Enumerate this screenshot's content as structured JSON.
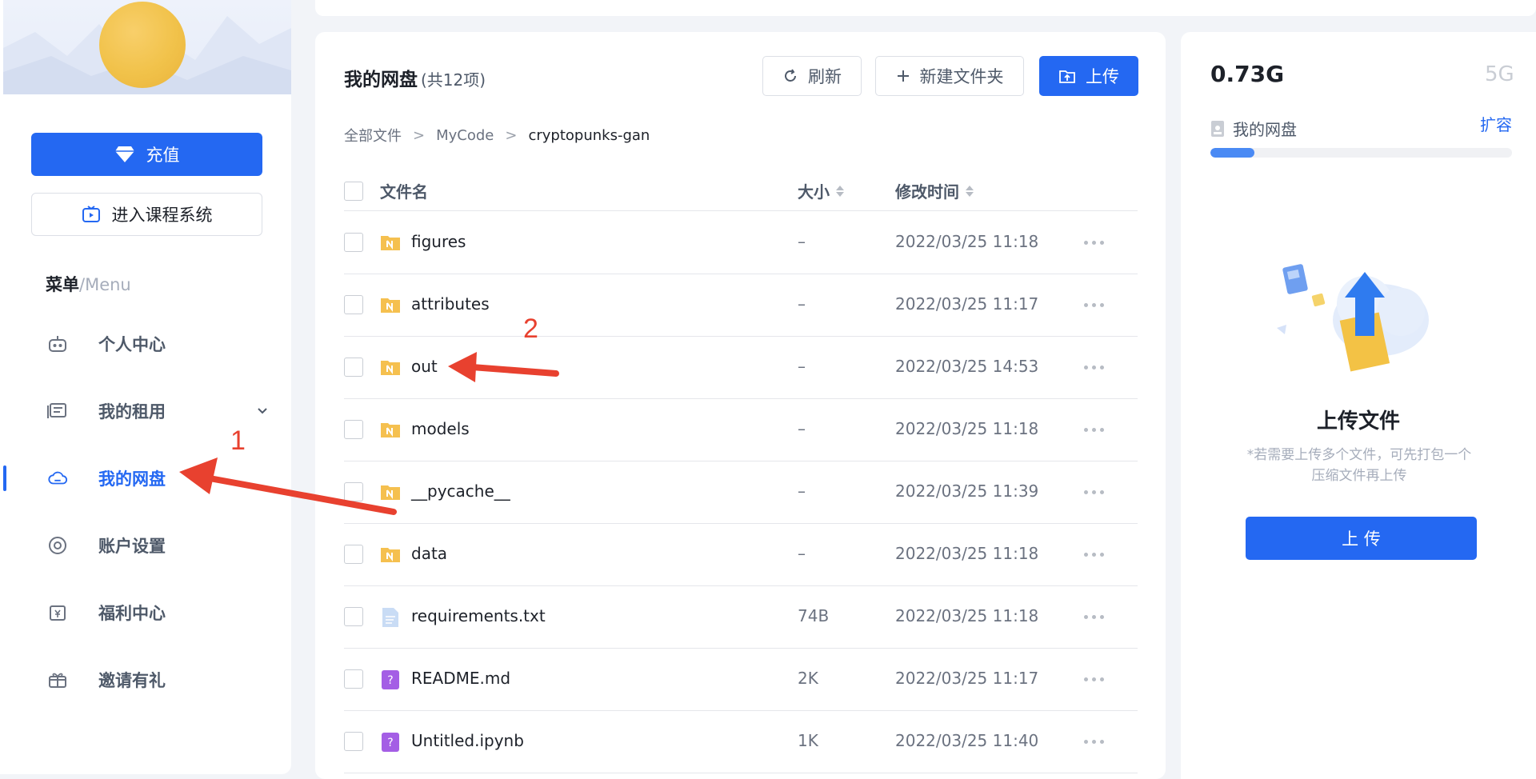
{
  "sidebar": {
    "recharge_label": "充值",
    "course_label": "进入课程系统",
    "menu_title": "菜单",
    "menu_title_en": "/Menu",
    "items": [
      {
        "label": "个人中心",
        "icon": "robot-icon"
      },
      {
        "label": "我的租用",
        "icon": "server-icon"
      },
      {
        "label": "我的网盘",
        "icon": "cloud-icon",
        "active": true
      },
      {
        "label": "账户设置",
        "icon": "settings-icon"
      },
      {
        "label": "福利中心",
        "icon": "coupon-icon"
      },
      {
        "label": "邀请有礼",
        "icon": "gift-icon"
      }
    ]
  },
  "main": {
    "title": "我的网盘",
    "count": "(共12项)",
    "refresh_label": "刷新",
    "new_folder_label": "新建文件夹",
    "upload_label": "上传",
    "breadcrumb": [
      "全部文件",
      "MyCode",
      "cryptopunks-gan"
    ],
    "breadcrumb_sep": ">",
    "columns": {
      "name": "文件名",
      "size": "大小",
      "time": "修改时间"
    },
    "files": [
      {
        "name": "figures",
        "type": "folder",
        "size": "–",
        "time": "2022/03/25 11:18"
      },
      {
        "name": "attributes",
        "type": "folder",
        "size": "–",
        "time": "2022/03/25 11:17"
      },
      {
        "name": "out",
        "type": "folder",
        "size": "–",
        "time": "2022/03/25 14:53"
      },
      {
        "name": "models",
        "type": "folder",
        "size": "–",
        "time": "2022/03/25 11:18"
      },
      {
        "name": "__pycache__",
        "type": "folder",
        "size": "–",
        "time": "2022/03/25 11:39"
      },
      {
        "name": "data",
        "type": "folder",
        "size": "–",
        "time": "2022/03/25 11:18"
      },
      {
        "name": "requirements.txt",
        "type": "text",
        "size": "74B",
        "time": "2022/03/25 11:18"
      },
      {
        "name": "README.md",
        "type": "unknown",
        "size": "2K",
        "time": "2022/03/25 11:17"
      },
      {
        "name": "Untitled.ipynb",
        "type": "unknown",
        "size": "1K",
        "time": "2022/03/25 11:40"
      }
    ]
  },
  "storage": {
    "used": "0.73G",
    "total": "5G",
    "label": "我的网盘",
    "expand_label": "扩容",
    "usage_fraction": 0.146,
    "upload_title": "上传文件",
    "upload_hint": "*若需要上传多个文件，可先打包一个压缩文件再上传",
    "upload_button": "上 传"
  },
  "annotations": [
    "1",
    "2"
  ],
  "colors": {
    "accent": "#2468f2",
    "annotation": "#e8412f",
    "folder": "#f5c04f",
    "text_file": "#c9dcf5",
    "unknown_file": "#a45ee5"
  }
}
